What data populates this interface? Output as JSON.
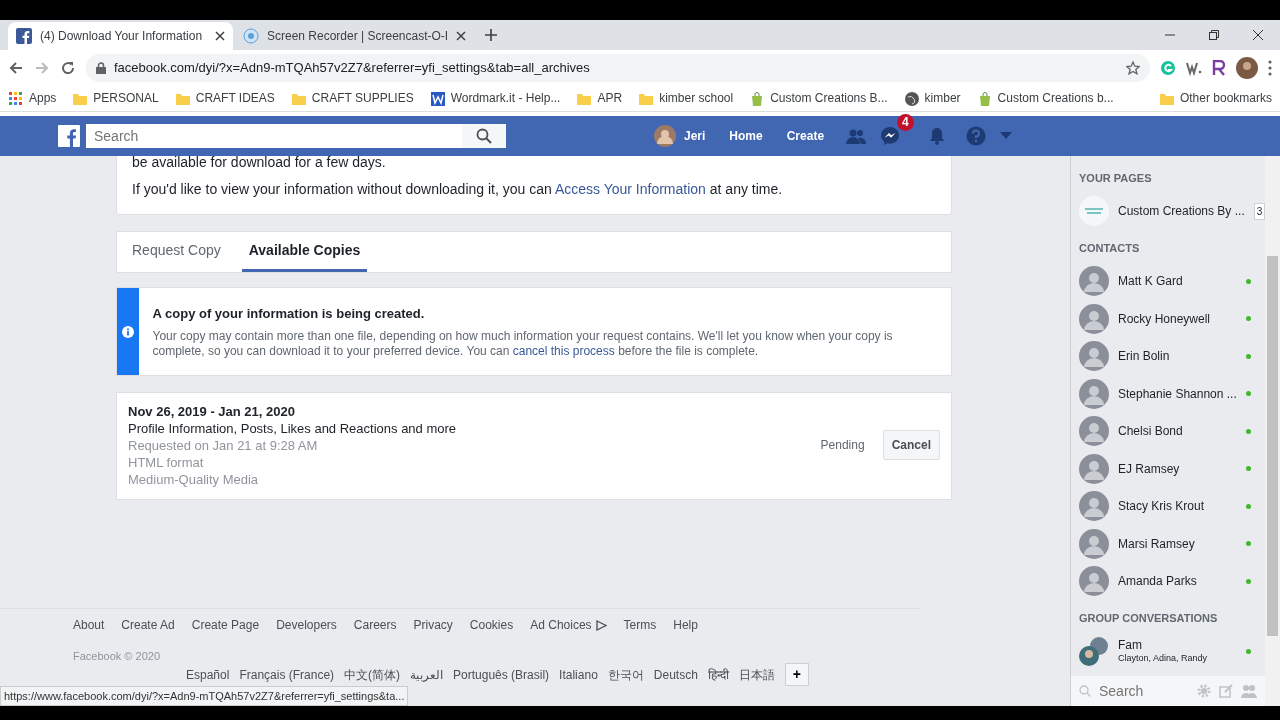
{
  "browser": {
    "tabs": [
      {
        "title": "(4) Download Your Information",
        "kind": "facebook",
        "selected": true
      },
      {
        "title": "Screen Recorder | Screencast-O-I",
        "kind": "recorder",
        "selected": false
      }
    ],
    "url": "facebook.com/dyi/?x=Adn9-mTQAh57v2Z7&referrer=yfi_settings&tab=all_archives",
    "bookmarks": [
      {
        "label": "Apps",
        "kind": "apps"
      },
      {
        "label": "PERSONAL",
        "kind": "folder"
      },
      {
        "label": "CRAFT IDEAS",
        "kind": "folder"
      },
      {
        "label": "CRAFT SUPPLIES",
        "kind": "folder"
      },
      {
        "label": "Wordmark.it - Help...",
        "kind": "doc"
      },
      {
        "label": "APR",
        "kind": "folder"
      },
      {
        "label": "kimber school",
        "kind": "folder"
      },
      {
        "label": "Custom Creations B...",
        "kind": "shop"
      },
      {
        "label": "kimber",
        "kind": "globe"
      },
      {
        "label": "Custom Creations b...",
        "kind": "shop"
      }
    ],
    "other_bookmarks": "Other bookmarks"
  },
  "header": {
    "search_placeholder": "Search",
    "user": "Jeri",
    "nav": [
      "Home",
      "Create"
    ],
    "messages_badge": "4"
  },
  "intro": {
    "cut_line": "be available for download for a few days.",
    "before": "If you'd like to view your information without downloading it, you can ",
    "link": "Access Your Information",
    "after": " at any time."
  },
  "tabs": [
    {
      "label": "Request Copy",
      "selected": false
    },
    {
      "label": "Available Copies",
      "selected": true
    }
  ],
  "notice": {
    "title": "A copy of your information is being created.",
    "before": "Your copy may contain more than one file, depending on how much information your request contains. We'll let you know when your copy is complete, so you can download it to your preferred device. You can ",
    "link": "cancel this process",
    "after": " before the file is complete."
  },
  "archive": {
    "date_range": "Nov 26, 2019 - Jan 21, 2020",
    "categories": "Profile Information, Posts, Likes and Reactions and more",
    "details": [
      "Requested on Jan 21 at 9:28 AM",
      "HTML format",
      "Medium-Quality Media"
    ],
    "status": "Pending",
    "action": "Cancel"
  },
  "sidebar": {
    "pages_heading": "YOUR PAGES",
    "pages": [
      {
        "name": "Custom Creations By ...",
        "count": "3"
      }
    ],
    "contacts_heading": "CONTACTS",
    "contacts": [
      {
        "name": "Matt K Gard",
        "online": true
      },
      {
        "name": "Rocky Honeywell",
        "online": true
      },
      {
        "name": "Erin Bolin",
        "online": true
      },
      {
        "name": "Stephanie Shannon ...",
        "online": true
      },
      {
        "name": "Chelsi Bond",
        "online": true
      },
      {
        "name": "EJ Ramsey",
        "online": true
      },
      {
        "name": "Stacy Kris Krout",
        "online": true
      },
      {
        "name": "Marsi Ramsey",
        "online": true
      },
      {
        "name": "Amanda Parks",
        "online": true
      }
    ],
    "groups_heading": "GROUP CONVERSATIONS",
    "groups": [
      {
        "name": "Fam",
        "members": "Clayton, Adina, Randy",
        "online": true
      }
    ],
    "search_placeholder": "Search"
  },
  "footer": {
    "links": [
      "About",
      "Create Ad",
      "Create Page",
      "Developers",
      "Careers",
      "Privacy",
      "Cookies",
      "Ad Choices",
      "Terms",
      "Help"
    ],
    "copyright": "Facebook © 2020",
    "languages": [
      "Español",
      "Français (France)",
      "中文(简体)",
      "العربية",
      "Português (Brasil)",
      "Italiano",
      "한국어",
      "Deutsch",
      "हिन्दी",
      "日本語"
    ],
    "more": "+"
  },
  "status_url": "https://www.facebook.com/dyi/?x=Adn9-mTQAh57v2Z7&referrer=yfi_settings&ta..."
}
